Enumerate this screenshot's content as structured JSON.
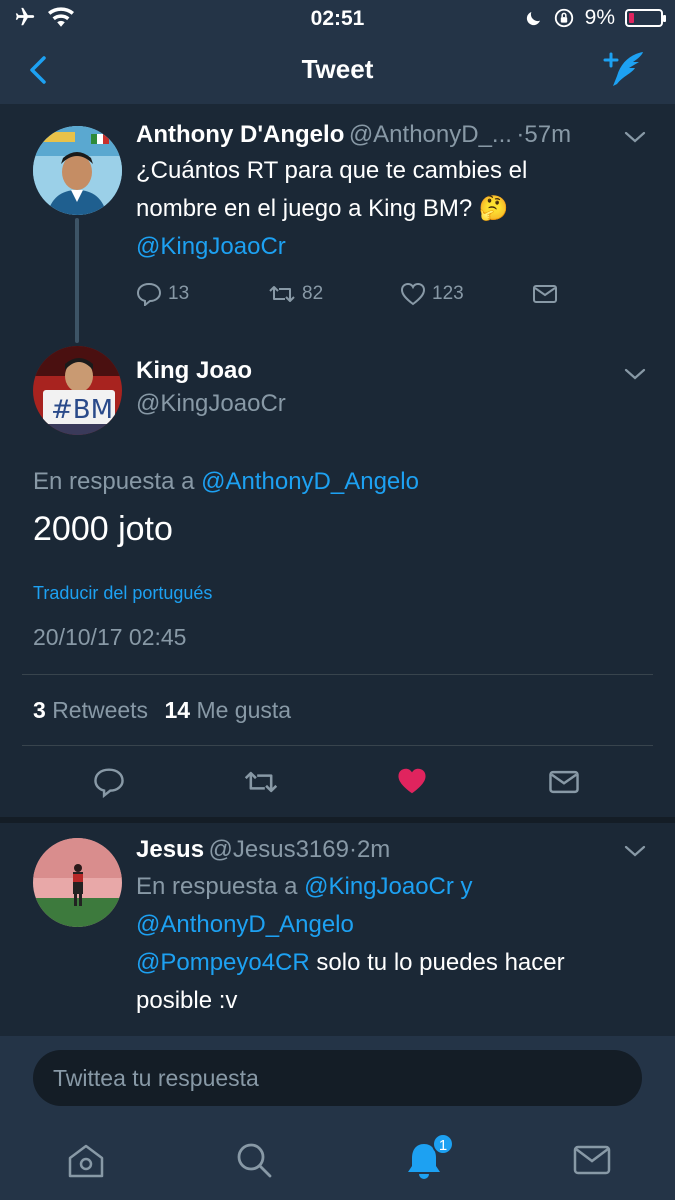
{
  "status_bar": {
    "time": "02:51",
    "battery_percent": "9%",
    "battery_level": 0.09,
    "icons": [
      "airplane-icon",
      "wifi-icon",
      "moon-icon",
      "rotation-lock-icon",
      "battery-icon"
    ]
  },
  "nav": {
    "title": "Tweet",
    "back_icon": "chevron-left-icon",
    "compose_icon": "compose-tweet-icon"
  },
  "parent_tweet": {
    "name": "Anthony D'Angelo",
    "handle": "@AnthonyD_...",
    "time": "·57m",
    "text_line1": "¿Cuántos RT para que te cambies el",
    "text_line2": "nombre en el juego a King BM? 🤔",
    "mention": "@KingJoaoCr",
    "replies": "13",
    "retweets": "82",
    "likes": "123"
  },
  "main_tweet": {
    "name": "King Joao",
    "handle": "@KingJoaoCr",
    "reply_prefix": "En respuesta a ",
    "reply_to": "@AnthonyD_Angelo",
    "text": "2000 joto",
    "translate": "Traducir del portugués",
    "timestamp": "20/10/17 02:45",
    "retweets_count": "3",
    "retweets_label": "Retweets",
    "likes_count": "14",
    "likes_label": "Me gusta"
  },
  "reply_tweet": {
    "name": "Jesus",
    "handle": "@Jesus3169",
    "time": "·2m",
    "reply_prefix": "En respuesta a ",
    "reply_to_1": "@KingJoaoCr",
    "reply_join": " y",
    "reply_to_2": "@AnthonyD_Angelo",
    "mention": "@Pompeyo4CR",
    "text_after_mention": " solo tu lo puedes hacer",
    "text_line2": "posible :v"
  },
  "reply_bar": {
    "placeholder": "Twittea tu respuesta"
  },
  "tab_bar": {
    "items": [
      "home-icon",
      "search-icon",
      "notifications-icon",
      "messages-icon"
    ],
    "notifications_badge": "1"
  },
  "colors": {
    "background": "#1b2836",
    "header": "#243447",
    "accent": "#1da1f2",
    "like": "#e0245e",
    "secondary_text": "#8899a6"
  }
}
